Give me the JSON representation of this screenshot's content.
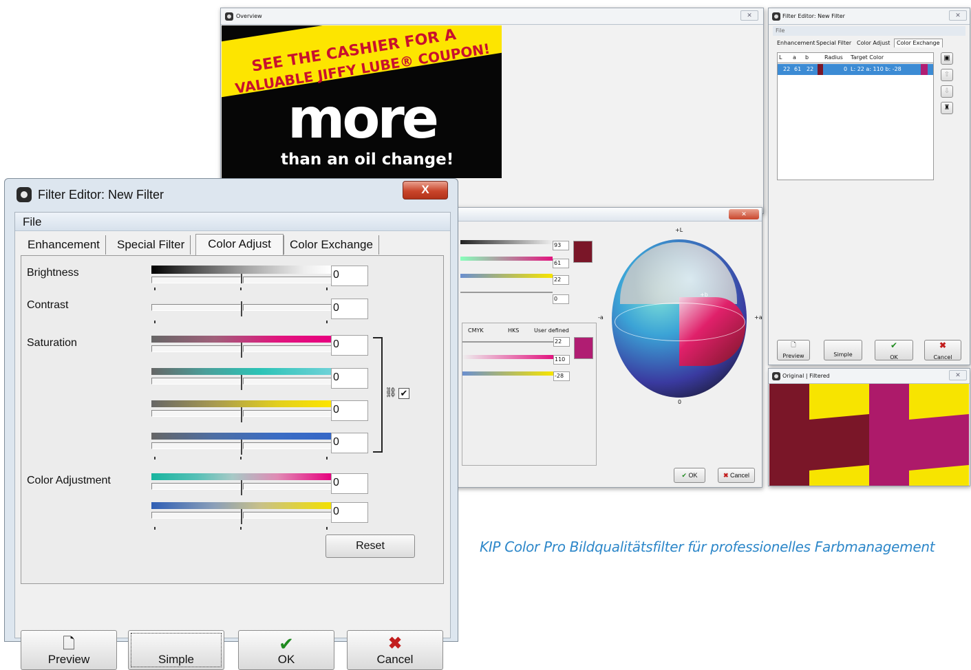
{
  "caption": "KIP Color Pro Bildqualitätsfilter für professionelles Farbmanagement",
  "overview": {
    "title": "Overview",
    "ad": {
      "line1": "SEE THE CASHIER FOR A",
      "line2": "VALUABLE JIFFY LUBE® COUPON!",
      "big": "more",
      "sub": "than an oil change!"
    }
  },
  "small_editor": {
    "title": "Filter Editor: New Filter",
    "menu": "File",
    "tabs": [
      "Enhancement",
      "Special Filter",
      "Color Adjust",
      "Color Exchange"
    ],
    "table": {
      "headers": [
        "L",
        "a",
        "b",
        "",
        "Radius",
        "Target Color"
      ],
      "row": {
        "L": "22",
        "a": "61",
        "b": "22",
        "radius": "0",
        "target": "L: 22 a: 110 b: -28"
      }
    },
    "buttons": [
      "Preview",
      "Simple",
      "OK",
      "Cancel"
    ]
  },
  "original_filtered": {
    "title": "Original | Filtered",
    "colors": {
      "maroon": "#7a1628",
      "magenta": "#ad1a6a",
      "yellow": "#f7e400"
    }
  },
  "color_dialog": {
    "source_values": [
      "93",
      "61",
      "22",
      "0"
    ],
    "tabs": [
      "CMYK",
      "HKS",
      "User defined"
    ],
    "target_values": [
      "22",
      "110",
      "-28"
    ],
    "source_swatch": "#7a1628",
    "target_swatch": "#b01d72",
    "axis_labels": {
      "top": "+L",
      "right": "+a",
      "left": "-a",
      "b": "+b",
      "bottom": "0"
    },
    "ok": "OK",
    "cancel": "Cancel"
  },
  "main_editor": {
    "title": "Filter Editor: New Filter",
    "close": "X",
    "menu": "File",
    "tabs": [
      "Enhancement",
      "Special Filter",
      "Color Adjust",
      "Color Exchange"
    ],
    "active_tab": "Color Adjust",
    "labels": {
      "brightness": "Brightness",
      "contrast": "Contrast",
      "saturation": "Saturation",
      "color_adjustment": "Color Adjustment"
    },
    "values": {
      "brightness": "0",
      "contrast": "0",
      "saturation": [
        "0",
        "0",
        "0",
        "0"
      ],
      "color_adjustment": [
        "0",
        "0"
      ]
    },
    "link_checked": true,
    "reset": "Reset",
    "buttons": {
      "preview": "Preview",
      "simple": "Simple",
      "ok": "OK",
      "cancel": "Cancel"
    }
  }
}
